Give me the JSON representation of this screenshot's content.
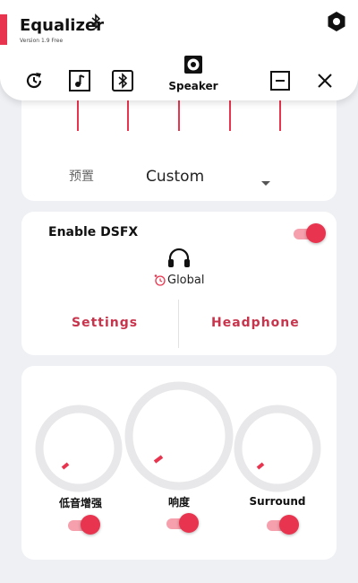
{
  "header": {
    "title": "Equalizer",
    "version": "Version 1.9 Free",
    "toolbar": {
      "reset_icon": "reset-icon",
      "music_icon": "music-note-icon",
      "bluetooth_icon": "bluetooth-icon",
      "speaker_label": "Speaker",
      "minimize_icon": "minimize-icon",
      "close_icon": "close-icon"
    }
  },
  "equalizer": {
    "preset_label": "预置",
    "preset_value": "Custom"
  },
  "dsfx": {
    "enable_label": "Enable DSFX",
    "enabled": true,
    "output_label": "Global",
    "settings_label": "Settings",
    "headphone_label": "Headphone"
  },
  "effects": {
    "knobs": [
      {
        "label": "低音增强",
        "enabled": true
      },
      {
        "label": "响度",
        "enabled": true
      },
      {
        "label": "Surround",
        "enabled": true
      }
    ]
  },
  "colors": {
    "accent": "#e8344e",
    "background": "#eef0f4",
    "card": "#ffffff"
  }
}
